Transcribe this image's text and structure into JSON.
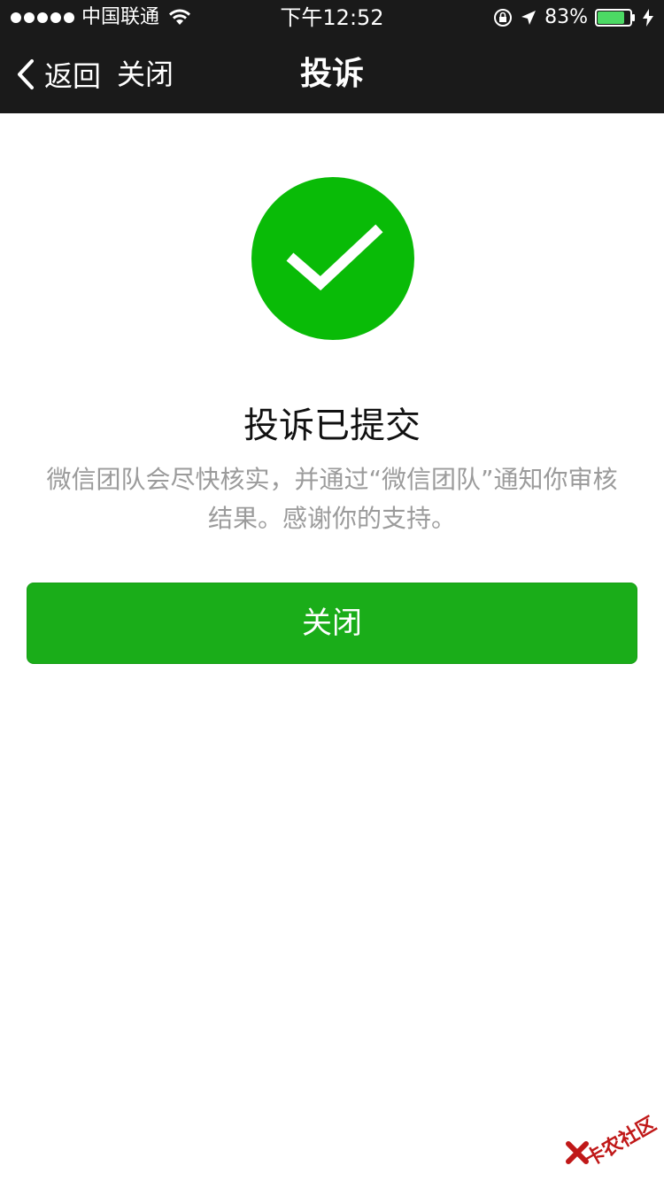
{
  "status_bar": {
    "carrier": "中国联通",
    "time": "下午12:52",
    "battery": "83%"
  },
  "nav": {
    "back_label": "返回",
    "close_label": "关闭",
    "title": "投诉"
  },
  "main": {
    "title": "投诉已提交",
    "description": "微信团队会尽快核实，并通过“微信团队”通知你审核结果。感谢你的支持。",
    "close_button_label": "关闭"
  },
  "watermark": {
    "text": "卡农社区"
  },
  "colors": {
    "nav_background": "#1a1a1a",
    "success_green": "#09bb07",
    "button_green": "#1aad19",
    "description_gray": "#9b9b9b"
  },
  "icons": {
    "success": "check-circle-icon",
    "back": "chevron-left-icon",
    "wifi": "wifi-icon",
    "rotation_lock": "rotation-lock-icon",
    "location": "location-arrow-icon",
    "battery": "battery-icon",
    "charging": "charging-bolt-icon"
  }
}
